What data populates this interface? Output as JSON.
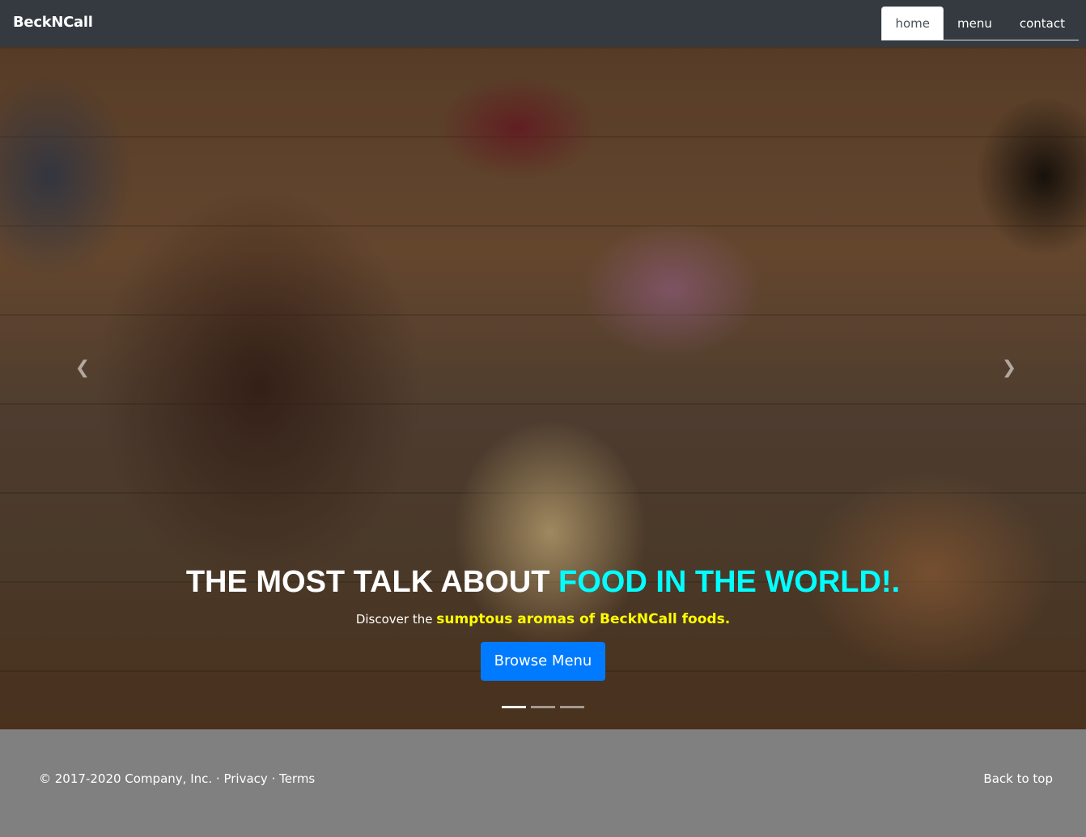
{
  "navbar": {
    "brand": "BeckNCall",
    "items": [
      {
        "label": "home",
        "active": true
      },
      {
        "label": "menu",
        "active": false
      },
      {
        "label": "contact",
        "active": false
      }
    ]
  },
  "hero": {
    "headline_plain": "THE MOST TALK ABOUT ",
    "headline_accent": "FOOD IN THE WORLD!.",
    "sub_plain": "Discover the ",
    "sub_highlight": "sumptous aromas of BeckNCall foods.",
    "button_label": "Browse Menu",
    "prev_icon": "chevron-left-icon",
    "next_icon": "chevron-right-icon",
    "slides": 3,
    "active_slide": 1
  },
  "footer": {
    "copyright": "© 2017-2020 Company, Inc. · ",
    "privacy": "Privacy",
    "separator": " · ",
    "terms": "Terms",
    "back_to_top": "Back to top"
  },
  "colors": {
    "navbar_bg": "#343a40",
    "accent_cyan": "#00ffff",
    "highlight_yellow": "#ffff00",
    "button_blue": "#007bff",
    "footer_bg": "#808080"
  }
}
